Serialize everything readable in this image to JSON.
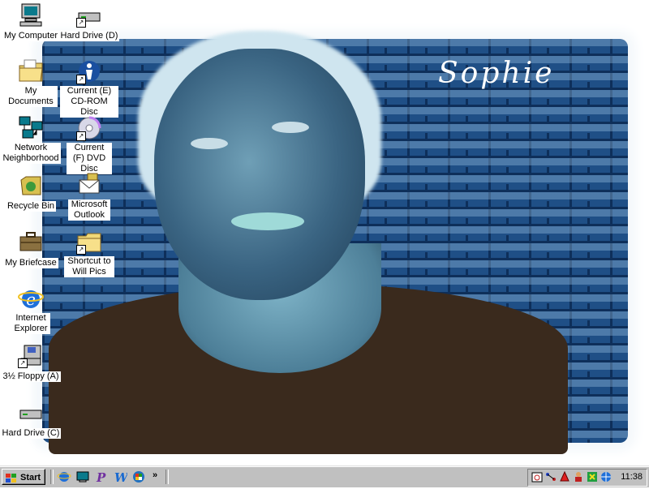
{
  "wallpaper": {
    "name_text": "Sophie"
  },
  "desktop_icons": [
    {
      "label": "My Computer",
      "icon": "my-computer-icon"
    },
    {
      "label": "Hard Drive (D)",
      "icon": "hard-drive-icon"
    },
    {
      "label": "My Documents",
      "icon": "folder-icon"
    },
    {
      "label": "Current (E) CD-ROM Disc",
      "icon": "cd-rom-icon"
    },
    {
      "label": "Network Neighborhood",
      "icon": "network-icon"
    },
    {
      "label": "Current (F) DVD Disc",
      "icon": "dvd-icon"
    },
    {
      "label": "Recycle Bin",
      "icon": "recycle-bin-icon"
    },
    {
      "label": "Microsoft Outlook",
      "icon": "outlook-icon"
    },
    {
      "label": "My Briefcase",
      "icon": "briefcase-icon"
    },
    {
      "label": "Shortcut to Will Pics",
      "icon": "folder-shortcut-icon"
    },
    {
      "label": "Internet Explorer",
      "icon": "internet-explorer-icon"
    },
    {
      "label": "3½ Floppy (A)",
      "icon": "floppy-icon"
    },
    {
      "label": "Hard Drive (C)",
      "icon": "hard-drive-icon"
    }
  ],
  "taskbar": {
    "start_label": "Start",
    "quick_launch": [
      "internet-explorer-icon",
      "show-desktop-icon",
      "paint-icon",
      "word-icon",
      "windows-update-icon"
    ],
    "overflow": "»",
    "tray_icons": [
      "scheduler-icon",
      "network-tray-icon",
      "alert-icon",
      "agent-icon",
      "media-icon",
      "browser-tray-icon"
    ],
    "clock": "11:38"
  },
  "colors": {
    "taskbar": "#c0c0c0",
    "label_bg": "#ffffff",
    "bricks": "#1f4f86"
  }
}
